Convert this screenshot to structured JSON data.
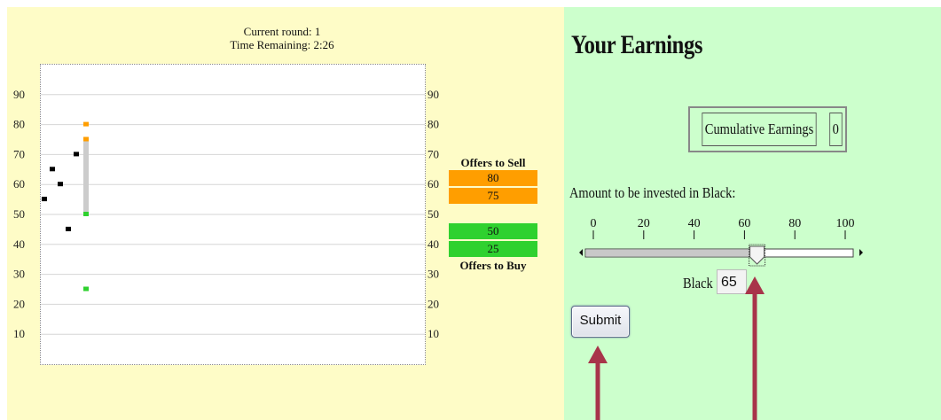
{
  "round": {
    "current_round_label": "Current round: 1",
    "time_remaining_label": "Time Remaining: 2:26"
  },
  "chart_data": {
    "type": "scatter",
    "title": "",
    "xlabel": "",
    "ylabel": "",
    "ylim": [
      0,
      100
    ],
    "y_ticks": [
      10,
      20,
      30,
      40,
      50,
      60,
      70,
      80,
      90
    ],
    "y_tick_labels": [
      "10",
      "20",
      "30",
      "40",
      "50",
      "60",
      "70",
      "80",
      "90"
    ],
    "grid": true,
    "series": [
      {
        "color": "#000000",
        "points": [
          [
            1,
            55
          ],
          [
            2,
            65
          ],
          [
            3,
            60
          ],
          [
            4,
            45
          ],
          [
            5,
            70
          ]
        ]
      },
      {
        "color": "#ff9e00",
        "points": [
          [
            6,
            80
          ],
          [
            6,
            75
          ]
        ]
      },
      {
        "color": "#2fd12f",
        "points": [
          [
            6,
            50
          ],
          [
            6,
            25
          ]
        ]
      }
    ],
    "spread_bar": {
      "x": 6,
      "from": 50,
      "to": 75,
      "color": "#cccccc"
    }
  },
  "offers": {
    "sell_heading": "Offers to Sell",
    "sell": [
      "80",
      "75"
    ],
    "buy": [
      "50",
      "25"
    ],
    "buy_heading": "Offers to Buy",
    "sell_color": "#ff9e00",
    "buy_color": "#2fd12f"
  },
  "earnings": {
    "title": "Your Earnings",
    "cumulative_label": "Cumulative Earnings",
    "cumulative_value": "0",
    "invest_label": "Amount to be invested in Black:",
    "scale_labels": [
      "0",
      "20",
      "40",
      "60",
      "80",
      "100"
    ],
    "slider_value": 65,
    "black_label": "Black",
    "black_value": "65",
    "submit_label": "Submit"
  },
  "colors": {
    "left_bg": "#fefcc7",
    "right_bg": "#ccffcc",
    "arrow": "#a8344a"
  }
}
